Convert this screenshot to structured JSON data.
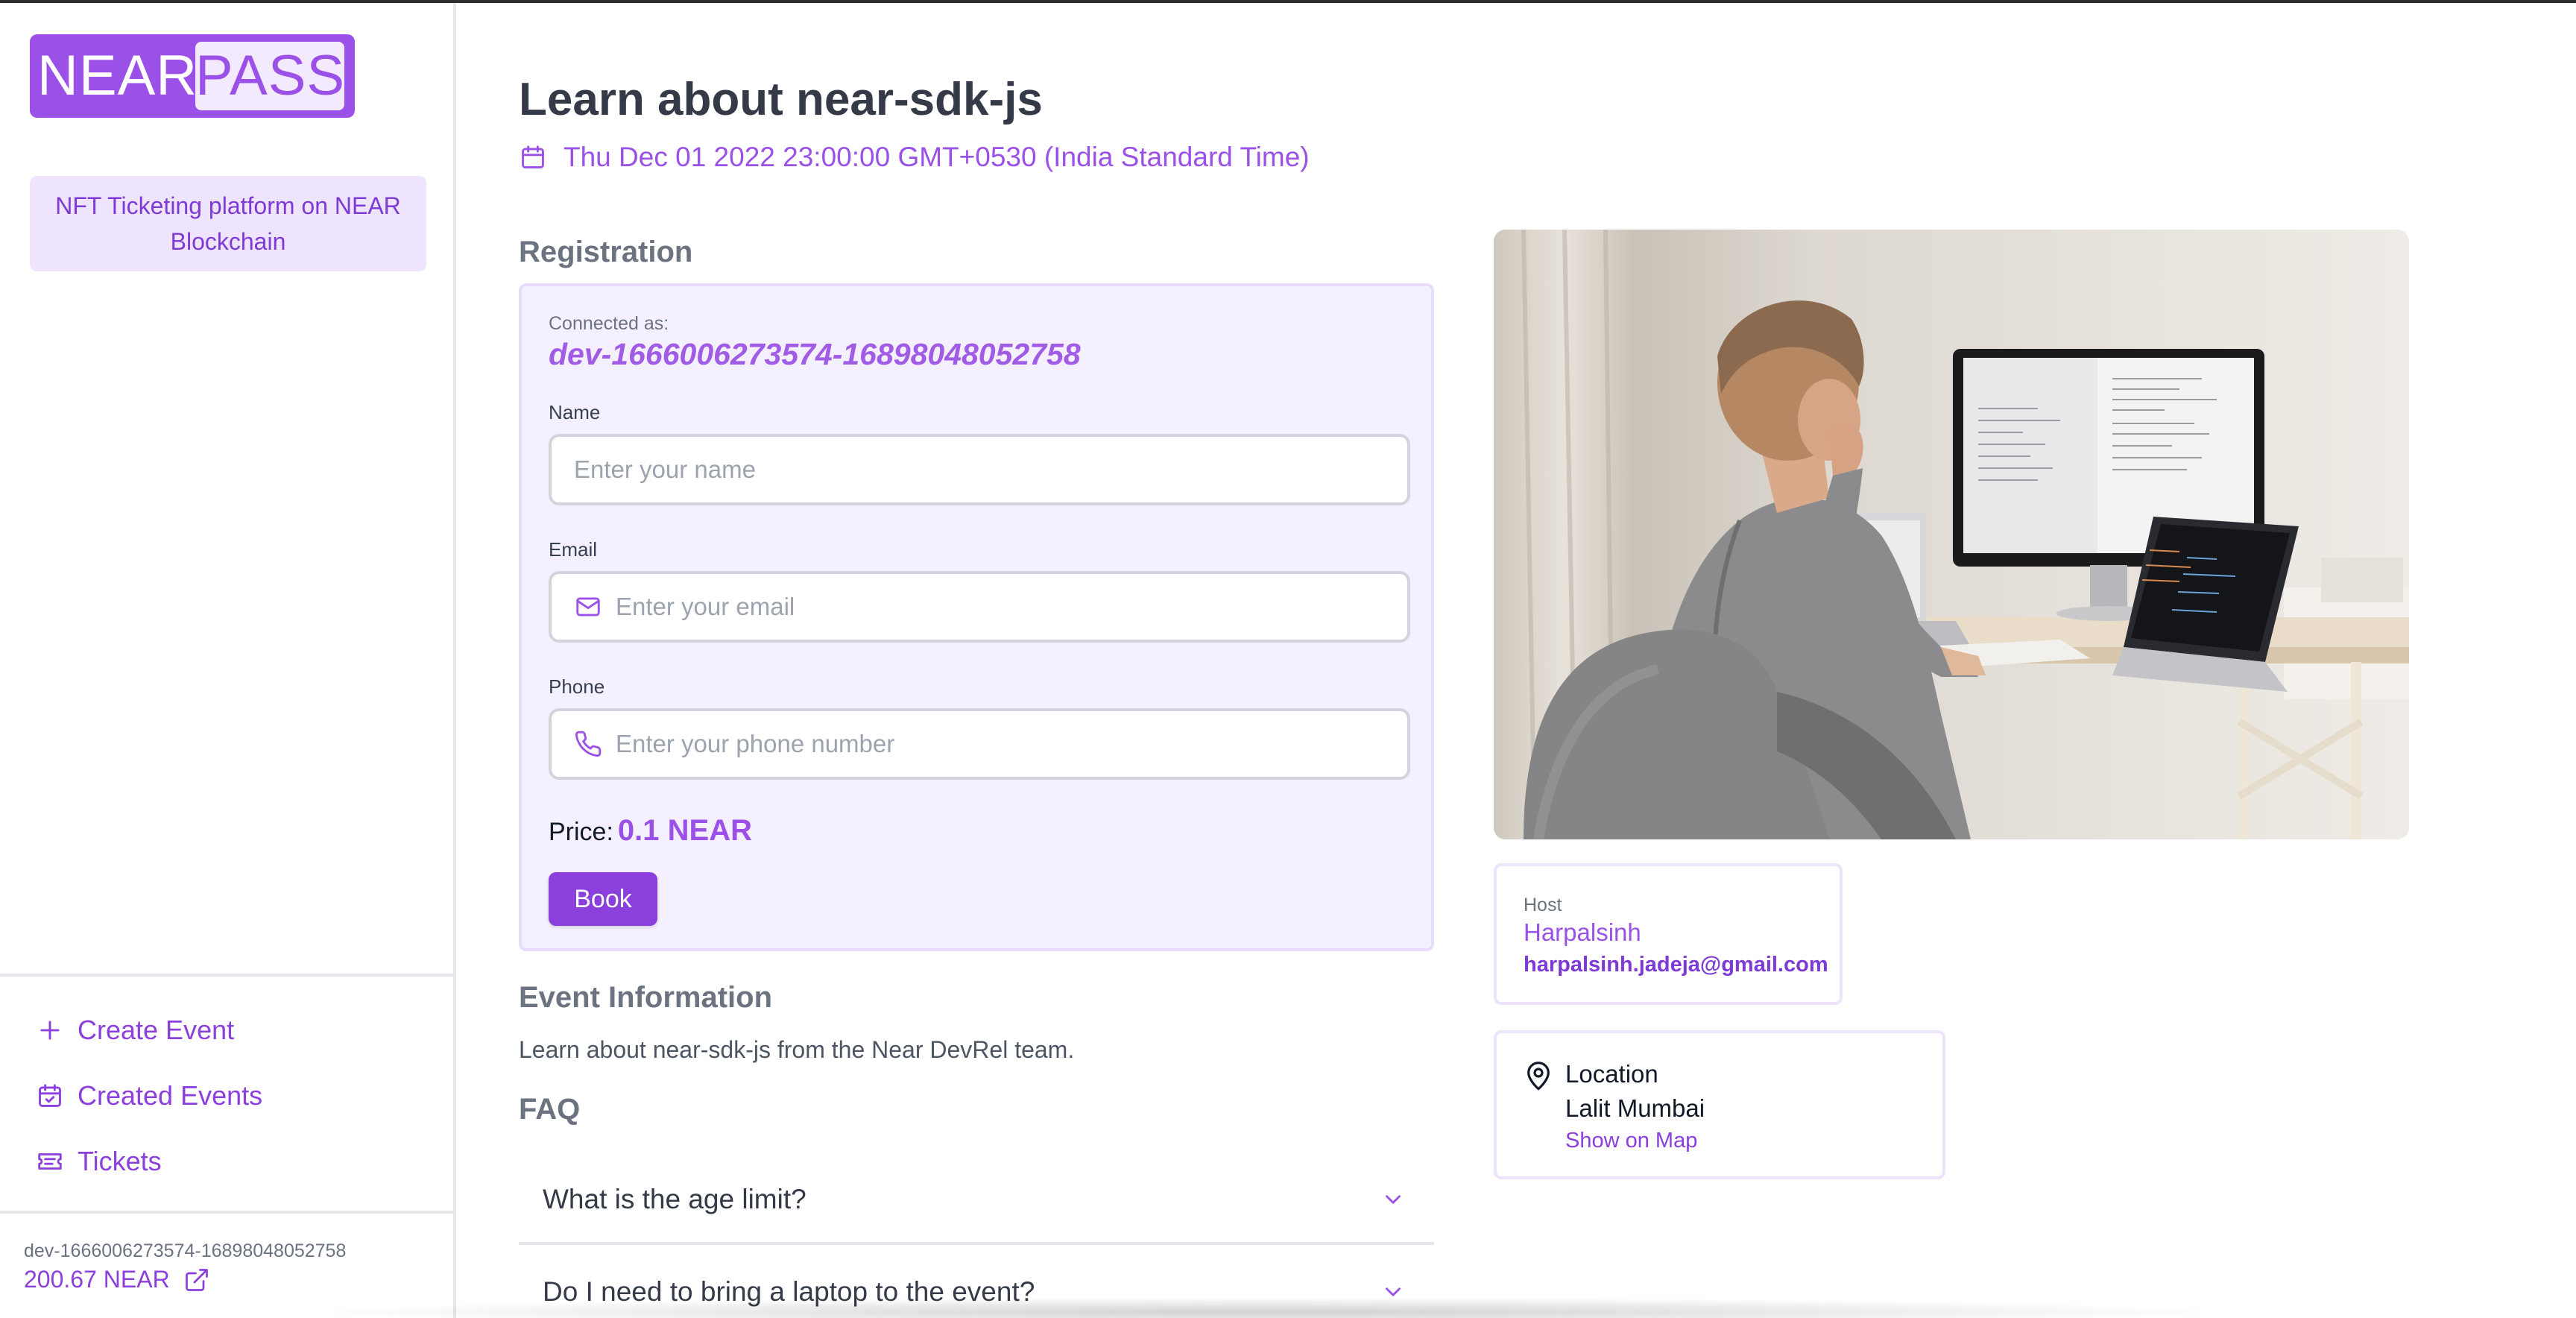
{
  "brand": {
    "near": "NEAR",
    "pass": "PASS"
  },
  "sidebar": {
    "tagline": "NFT Ticketing platform on NEAR Blockchain",
    "nav": [
      {
        "label": "Create Event",
        "icon": "plus-icon"
      },
      {
        "label": "Created Events",
        "icon": "calendar-check-icon"
      },
      {
        "label": "Tickets",
        "icon": "ticket-icon"
      }
    ],
    "account_id": "dev-1666006273574-16898048052758",
    "balance": "200.67 NEAR"
  },
  "event": {
    "title": "Learn about near-sdk-js",
    "date": "Thu Dec 01 2022 23:00:00 GMT+0530 (India Standard Time)"
  },
  "registration": {
    "heading": "Registration",
    "connected_label": "Connected as:",
    "connected_id": "dev-1666006273574-16898048052758",
    "name_label": "Name",
    "name_placeholder": "Enter your name",
    "email_label": "Email",
    "email_placeholder": "Enter your email",
    "phone_label": "Phone",
    "phone_placeholder": "Enter your phone number",
    "price_label": "Price:",
    "price_value": "0.1 NEAR",
    "book_label": "Book"
  },
  "info": {
    "heading": "Event Information",
    "text": "Learn about near-sdk-js from the Near DevRel team."
  },
  "faq": {
    "heading": "FAQ",
    "items": [
      "What is the age limit?",
      "Do I need to bring a laptop to the event?"
    ]
  },
  "host": {
    "label": "Host",
    "name": "Harpalsinh",
    "email": "harpalsinh.jadeja@gmail.com"
  },
  "location": {
    "label": "Location",
    "name": "Lalit Mumbai",
    "map_link": "Show on Map"
  },
  "colors": {
    "accent": "#9b51e8",
    "accent_dark": "#8b3fdd",
    "card_bg": "#f5f0ff"
  }
}
